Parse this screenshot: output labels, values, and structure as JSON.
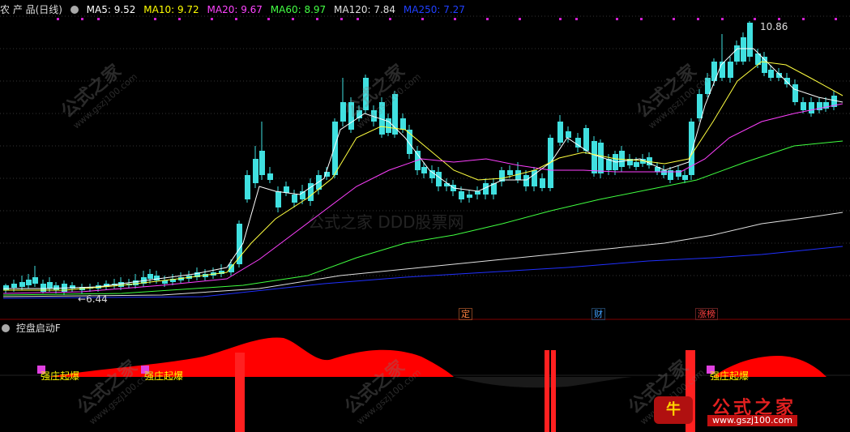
{
  "header": {
    "title": "农 产 品(日线)",
    "indicators": [
      {
        "label": "MA5: 9.52",
        "color": "#ffffff"
      },
      {
        "label": "MA10: 9.72",
        "color": "#ffff00"
      },
      {
        "label": "MA20: 9.67",
        "color": "#ff40ff"
      },
      {
        "label": "MA60: 8.97",
        "color": "#40ff40"
      },
      {
        "label": "MA120: 7.84",
        "color": "#e0e0e0"
      },
      {
        "label": "MA250: 7.27",
        "color": "#2040ff"
      }
    ]
  },
  "price_labels": {
    "high": "10.86",
    "low": "6.44"
  },
  "event_tags": [
    {
      "label": "定",
      "color": "#ff8040"
    },
    {
      "label": "财",
      "color": "#40a0ff"
    },
    {
      "label": "涨榜",
      "color": "#ff4040"
    }
  ],
  "sub_panel": {
    "title": "控盘启动F",
    "signals": [
      "强庄起爆",
      "强庄起爆",
      "强庄起爆"
    ]
  },
  "watermark": {
    "text": "公式之家",
    "url": "www.gszj100.com"
  },
  "colors": {
    "up": "#ff3030",
    "down": "#40e0e0",
    "background": "#000000"
  }
}
